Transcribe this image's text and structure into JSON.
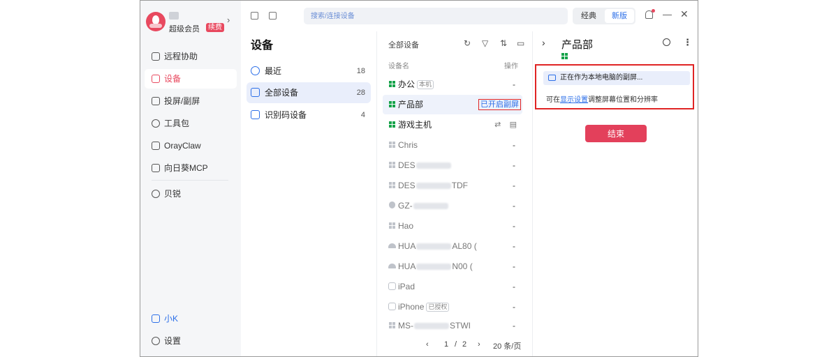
{
  "user": {
    "level": "超级会员",
    "renew_label": "续费"
  },
  "nav": [
    {
      "label": "远程协助"
    },
    {
      "label": "设备"
    },
    {
      "label": "投屏/副屏"
    },
    {
      "label": "工具包"
    },
    {
      "label": "OrayClaw"
    },
    {
      "label": "向日葵MCP"
    },
    {
      "label": "贝锐"
    }
  ],
  "nav_bottom": {
    "xiaok": "小K",
    "settings": "设置"
  },
  "topbar": {
    "search_placeholder": "搜索/连接设备",
    "mode_classic": "经典",
    "mode_new": "新版"
  },
  "groups": {
    "title": "设备",
    "items": [
      {
        "label": "最近",
        "count": "18"
      },
      {
        "label": "全部设备",
        "count": "28"
      },
      {
        "label": "识别码设备",
        "count": "4"
      }
    ]
  },
  "device_list": {
    "title": "全部设备",
    "col_name": "设备名",
    "col_op": "操作",
    "devices": [
      {
        "name": "办公",
        "tag": "本机",
        "op": "-"
      },
      {
        "name": "产品部",
        "op_badge": "已开启副屏"
      },
      {
        "name": "游戏主机"
      },
      {
        "name": "Chris",
        "op": "-"
      },
      {
        "name": "DES",
        "op": "-"
      },
      {
        "name": "DES",
        "suffix": "TDF",
        "op": "-"
      },
      {
        "name": "GZ-",
        "op": "-"
      },
      {
        "name": "Hao",
        "op": "-"
      },
      {
        "name": "HUA",
        "suffix": "AL80 (",
        "op": "-"
      },
      {
        "name": "HUA",
        "suffix": "N00 (",
        "op": "-"
      },
      {
        "name": "iPad",
        "op": "-"
      },
      {
        "name": "iPhone",
        "tag": "已授权",
        "op": "-"
      },
      {
        "name": "MS-",
        "suffix": "STWI",
        "op": "-"
      }
    ],
    "pager": {
      "prev": "‹",
      "current": "1",
      "sep": "/",
      "total": "2",
      "next": "›",
      "per_page": "20 条/页"
    }
  },
  "detail": {
    "title": "产品部",
    "status": "正在作为本地电脑的副屏...",
    "hint_prefix": "可在",
    "hint_link": "显示设置",
    "hint_suffix": "调整屏幕位置和分辨率",
    "end_button": "结束"
  },
  "colors": {
    "accent": "#e8495f",
    "primary": "#2c6fe8",
    "online": "#16a34a",
    "highlight_border": "#e02424"
  }
}
